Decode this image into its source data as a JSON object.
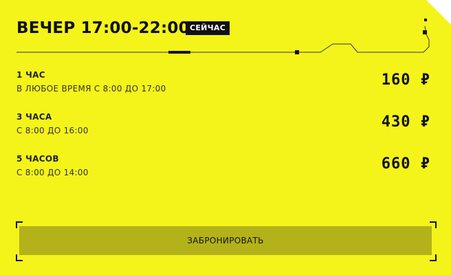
{
  "header": {
    "title": "ВЕЧЕР 17:00-22:00",
    "badge": "СЕЙЧАС"
  },
  "plans": [
    {
      "name": "1 ЧАС",
      "time": "В ЛЮБОЕ ВРЕМЯ С 8:00 ДО 17:00",
      "price": "160 ₽"
    },
    {
      "name": "3 ЧАСА",
      "time": "С 8:00 ДО 16:00",
      "price": "430 ₽"
    },
    {
      "name": "5 ЧАСОВ",
      "time": "С 8:00 ДО 14:00",
      "price": "660 ₽"
    }
  ],
  "actions": {
    "book_label": "ЗАБРОНИРОВАТЬ"
  },
  "colors": {
    "card_background": "#f4f41a",
    "button_background": "#b3b21a",
    "text": "#111111",
    "badge_background": "#111111",
    "badge_text": "#ffffff"
  }
}
